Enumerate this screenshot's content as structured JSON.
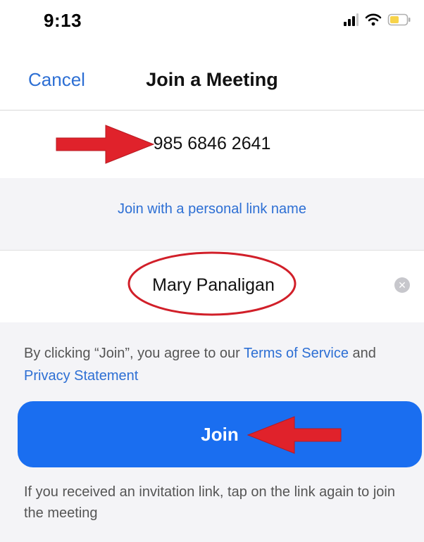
{
  "status_bar": {
    "time": "9:13",
    "icons": [
      "signal-icon",
      "wifi-icon",
      "battery-icon"
    ],
    "battery_color": "#f7d34a"
  },
  "nav": {
    "cancel_label": "Cancel",
    "title": "Join a Meeting"
  },
  "meeting": {
    "id_value": "985 6846 2641"
  },
  "personal_link": {
    "label": "Join with a personal link name"
  },
  "name_field": {
    "value": "Mary Panaligan"
  },
  "terms": {
    "prefix": "By clicking “Join”, you agree to our ",
    "terms_link": "Terms of Service",
    "middle": " and",
    "privacy_link": "Privacy Statement"
  },
  "join_button": {
    "label": "Join"
  },
  "hint": {
    "text": "If you received an invitation link, tap on the link again to join the meeting"
  },
  "colors": {
    "accent": "#2d6fd4",
    "join_button": "#1a6ef0",
    "annotation_red": "#e0222b",
    "section_background": "#f4f4f7"
  }
}
